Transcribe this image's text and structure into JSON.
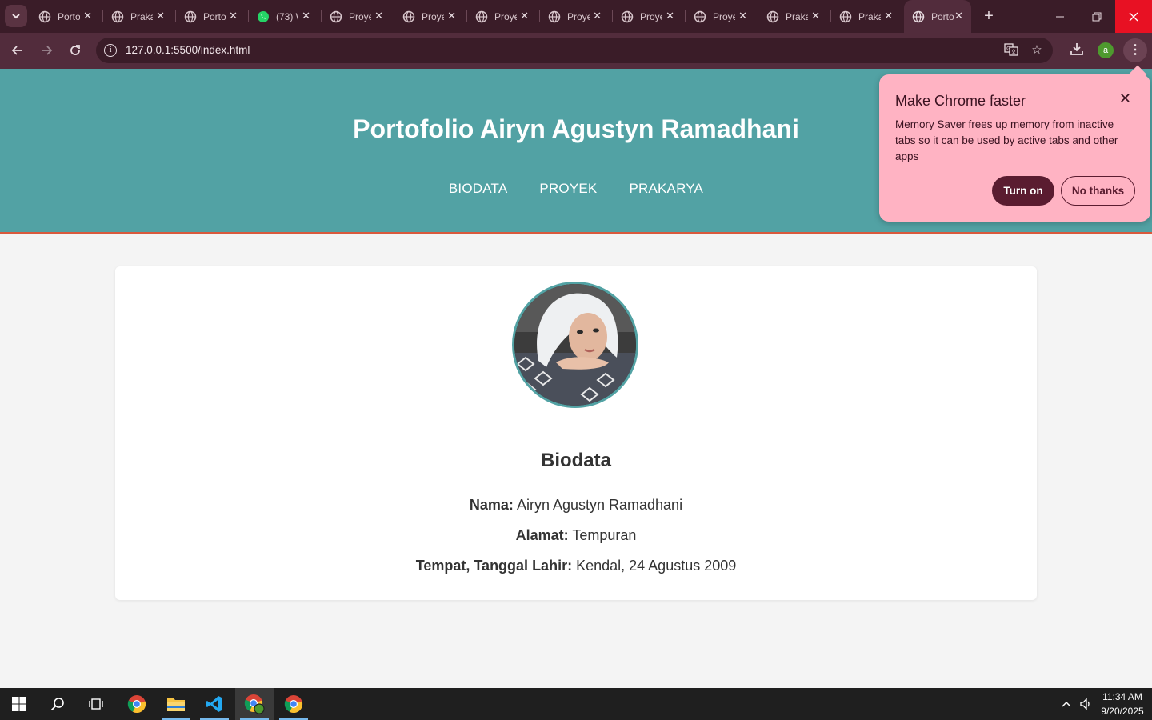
{
  "browser": {
    "tabs": [
      {
        "title": "Porto",
        "icon": "globe-icon"
      },
      {
        "title": "Praka",
        "icon": "globe-icon"
      },
      {
        "title": "Porto",
        "icon": "globe-icon"
      },
      {
        "title": "(73) W",
        "icon": "whatsapp-icon"
      },
      {
        "title": "Proye",
        "icon": "globe-icon"
      },
      {
        "title": "Proye",
        "icon": "globe-icon"
      },
      {
        "title": "Proye",
        "icon": "globe-icon"
      },
      {
        "title": "Proye",
        "icon": "globe-icon"
      },
      {
        "title": "Proye",
        "icon": "globe-icon"
      },
      {
        "title": "Proye",
        "icon": "globe-icon"
      },
      {
        "title": "Praka",
        "icon": "globe-icon"
      },
      {
        "title": "Praka",
        "icon": "globe-icon"
      },
      {
        "title": "Porto",
        "icon": "globe-icon",
        "active": true
      }
    ],
    "url": "127.0.0.1:5500/index.html",
    "profile_initial": "a",
    "accent": "#522c3c"
  },
  "promo": {
    "title": "Make Chrome faster",
    "body": "Memory Saver frees up memory from inactive tabs so it can be used by active tabs and other apps",
    "primary": "Turn on",
    "secondary": "No thanks",
    "color": "#ffb3c3"
  },
  "page": {
    "title": "Portofolio Airyn Agustyn Ramadhani",
    "nav": [
      "BIODATA",
      "PROYEK",
      "PRAKARYA"
    ],
    "header_color": "#52a2a4",
    "header_border_color": "#d9593c",
    "section_title": "Biodata",
    "bio": [
      {
        "label": "Nama:",
        "value": "Airyn Agustyn Ramadhani"
      },
      {
        "label": "Alamat:",
        "value": "Tempuran"
      },
      {
        "label": "Tempat, Tanggal Lahir:",
        "value": "Kendal, 24 Agustus 2009"
      }
    ]
  },
  "taskbar": {
    "time": "11:34 AM",
    "date": "9/20/2025"
  }
}
